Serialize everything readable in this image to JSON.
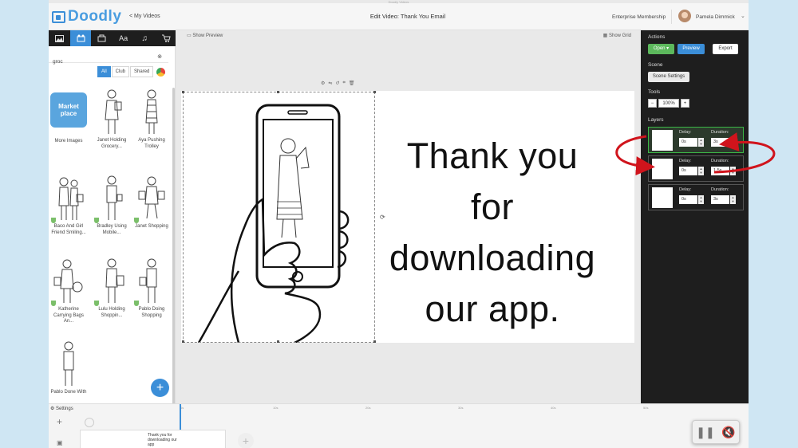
{
  "window": {
    "title": "Doodly Videos"
  },
  "header": {
    "logo": "Doodly",
    "back_link": "< My Videos",
    "edit_title": "Edit Video: Thank You Email",
    "membership": "Enterprise Membership",
    "user_name": "Pamela Dimmick",
    "caret": "⌄"
  },
  "left_panel": {
    "tabs": [
      "image-icon",
      "scene-icon",
      "props-icon",
      "text-icon",
      "music-icon",
      "cart-icon"
    ],
    "search": {
      "value": "groc",
      "placeholder": "Search"
    },
    "filters": [
      "All",
      "Club",
      "Shared"
    ],
    "active_filter": "All",
    "market": {
      "tile": "Market place",
      "label": "More Images"
    },
    "items": [
      {
        "label": "Janet Holding Grocery..."
      },
      {
        "label": "Aya Pushing Trolley"
      },
      {
        "label": "Baco And Girl Friend Smiling..."
      },
      {
        "label": "Bradley Using Mobile..."
      },
      {
        "label": "Janet Shopping"
      },
      {
        "label": "Katherine Carrying Bags An..."
      },
      {
        "label": "Lulu Holding Shoppin..."
      },
      {
        "label": "Pablo Doing Shopping"
      },
      {
        "label": "Pablo Done With"
      }
    ],
    "fab": "+"
  },
  "canvas": {
    "show_preview": "Show Preview",
    "show_grid": "Show Grid",
    "headline_lines": [
      "Thank you for",
      "downloading",
      "our app."
    ]
  },
  "right_panel": {
    "actions_label": "Actions",
    "open": "Open ▾",
    "preview": "Preview",
    "export": "Export",
    "scene_label": "Scene",
    "scene_settings": "Scene Settings",
    "tools_label": "Tools",
    "zoom_minus": "−",
    "zoom": "100%",
    "zoom_plus": "+",
    "layers_label": "Layers",
    "delay_label": "Delay:",
    "duration_label": "Duration:",
    "layers": [
      {
        "delay": "0s",
        "duration": "3s"
      },
      {
        "delay": "0s",
        "duration": "1.5s"
      },
      {
        "delay": "0s",
        "duration": "3s"
      }
    ]
  },
  "timeline": {
    "settings": "⚙ Settings",
    "clip_text": "Thank you for downloading our app",
    "add": "+",
    "ruler_marks": [
      "0s",
      "10s",
      "20s",
      "30s",
      "40s",
      "50s"
    ]
  },
  "colors": {
    "accent": "#3b8ed8",
    "active_layer": "#3cb846",
    "annotation": "#d0141c",
    "panel_dark": "#1e1e1e"
  }
}
